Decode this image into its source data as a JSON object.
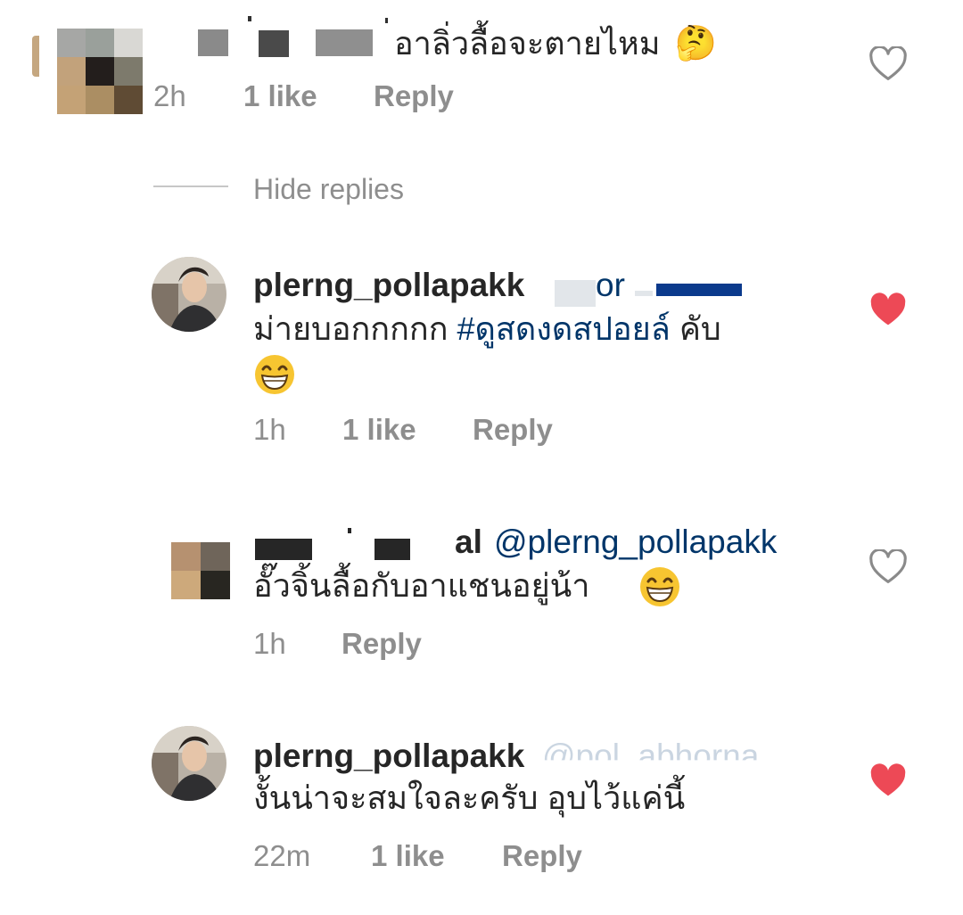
{
  "comments": [
    {
      "text": "อาลิ่วลื้อจะตายไหม",
      "emoji": "🤔",
      "meta": {
        "time": "2h",
        "likes": "1 like",
        "reply": "Reply"
      },
      "liked": false
    }
  ],
  "hide_replies": "Hide replies",
  "replies": [
    {
      "username": "plerng_pollapakk",
      "mention_fragment": "or",
      "text_line1_prefix": "ม่ายบอกกกกก ",
      "hashtag": "#ดูสดงดสปอยล์",
      "text_line1_suffix": " คับ",
      "meta": {
        "time": "1h",
        "likes": "1 like",
        "reply": "Reply"
      },
      "liked": true
    },
    {
      "username_fragment": "al",
      "mention": "@plerng_pollapakk",
      "text": "อั๊วจิ้นลื้อกับอาแชนอยู่น้า",
      "meta": {
        "time": "1h",
        "reply": "Reply"
      },
      "liked": false
    },
    {
      "username": "plerng_pollapakk",
      "mention_faded": "@pol_abhorna",
      "text": "งั้นน่าจะสมใจละครับ อุบไว้แค่นี้",
      "meta": {
        "time": "22m",
        "likes": "1 like",
        "reply": "Reply"
      },
      "liked": true
    }
  ],
  "colors": {
    "text": "#262626",
    "secondary": "#8e8e8e",
    "link": "#003569",
    "heart_liked": "#ed4956"
  }
}
